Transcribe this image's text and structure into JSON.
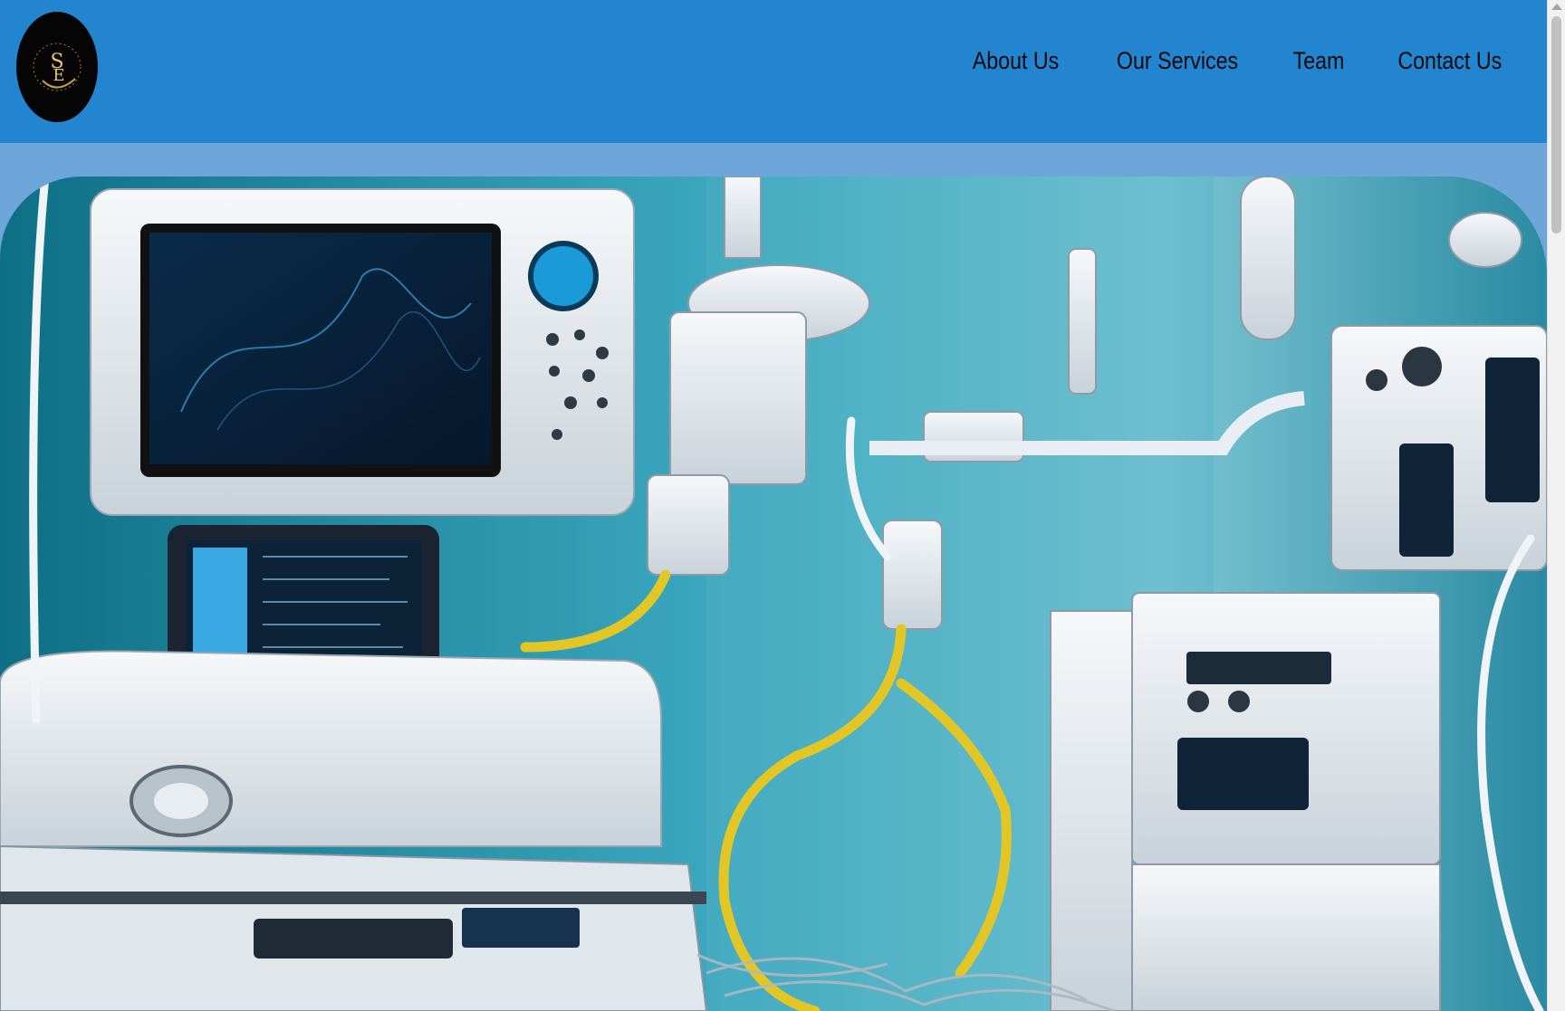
{
  "brand": {
    "logo_monogram": "SE",
    "logo_icon": "se-monogram-logo",
    "logo_bg": "#050505",
    "logo_accent": "#c9a13b"
  },
  "nav": {
    "items": [
      {
        "label": "About Us"
      },
      {
        "label": "Our Services"
      },
      {
        "label": "Team"
      },
      {
        "label": "Contact Us"
      }
    ]
  },
  "hero": {
    "image_icon": "medical-equipment-image"
  },
  "colors": {
    "header_bg": "#2384cf",
    "page_bg": "#6ea6da",
    "nav_text": "#0b0b0b"
  }
}
